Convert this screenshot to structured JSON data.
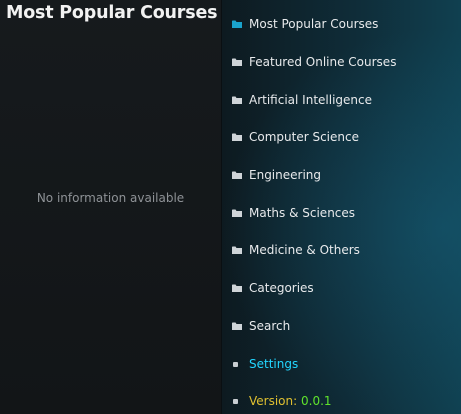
{
  "left_panel": {
    "title": "Most Popular Courses",
    "info_text": "No information available"
  },
  "menu": {
    "items": [
      {
        "label": "Most Popular Courses",
        "icon": "folder-icon",
        "active": true
      },
      {
        "label": "Featured Online Courses",
        "icon": "folder-icon"
      },
      {
        "label": "Artificial Intelligence",
        "icon": "folder-icon"
      },
      {
        "label": "Computer Science",
        "icon": "folder-icon"
      },
      {
        "label": "Engineering",
        "icon": "folder-icon"
      },
      {
        "label": "Maths & Sciences",
        "icon": "folder-icon"
      },
      {
        "label": "Medicine & Others",
        "icon": "folder-icon"
      },
      {
        "label": "Categories",
        "icon": "folder-icon"
      },
      {
        "label": "Search",
        "icon": "folder-icon"
      },
      {
        "label": "Settings",
        "icon": "dot-icon"
      }
    ],
    "version": {
      "label": "Version:",
      "value": "0.0.1",
      "icon": "dot-icon"
    }
  },
  "colors": {
    "active_folder": "#1aa3cc",
    "folder": "#cfd4d8",
    "settings_text": "#22d6ff",
    "version_label": "#e0c030",
    "version_value": "#5fe32c"
  }
}
